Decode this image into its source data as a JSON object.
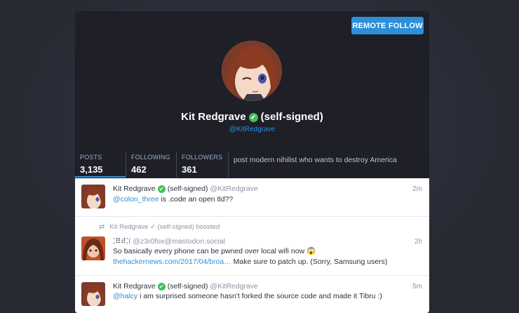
{
  "header": {
    "remote_follow": "REMOTE FOLLOW",
    "display_name": "Kit Redgrave",
    "name_suffix": "(self-signed)",
    "handle": "@KitRedgrave"
  },
  "stats": [
    {
      "label": "POSTS",
      "value": "3,135"
    },
    {
      "label": "FOLLOWING",
      "value": "462"
    },
    {
      "label": "FOLLOWERS",
      "value": "361"
    }
  ],
  "bio": "post modern nihilist who wants to destroy America",
  "statuses": [
    {
      "name": "Kit Redgrave",
      "suffix": "(self-signed)",
      "acct": "@KitRedgrave",
      "time": "2m",
      "mention": "@colon_three",
      "text": " is .code an open tld??"
    },
    {
      "boosted_by": "Kit Redgrave ✓ (self-signed) boosted",
      "name": "⁚⠿⠾⁚⁝",
      "acct": "@z3r0fox@mastodon.social",
      "time": "2h",
      "line1": "So basically every phone can be pwned over local wifi now 😱",
      "link": "thehackernews.com/2017/04/broa…",
      "line2": " Make sure to patch up. (Sorry, Samsung users)"
    },
    {
      "name": "Kit Redgrave",
      "suffix": "(self-signed)",
      "acct": "@KitRedgrave",
      "time": "5m",
      "mention": "@halcy",
      "text": " i am surprised someone hasn't forked the source code and made it Tibru :)"
    }
  ],
  "colors": {
    "accent": "#2b90d9",
    "verified": "#3cc25a",
    "card_bg": "#1e1f27"
  }
}
